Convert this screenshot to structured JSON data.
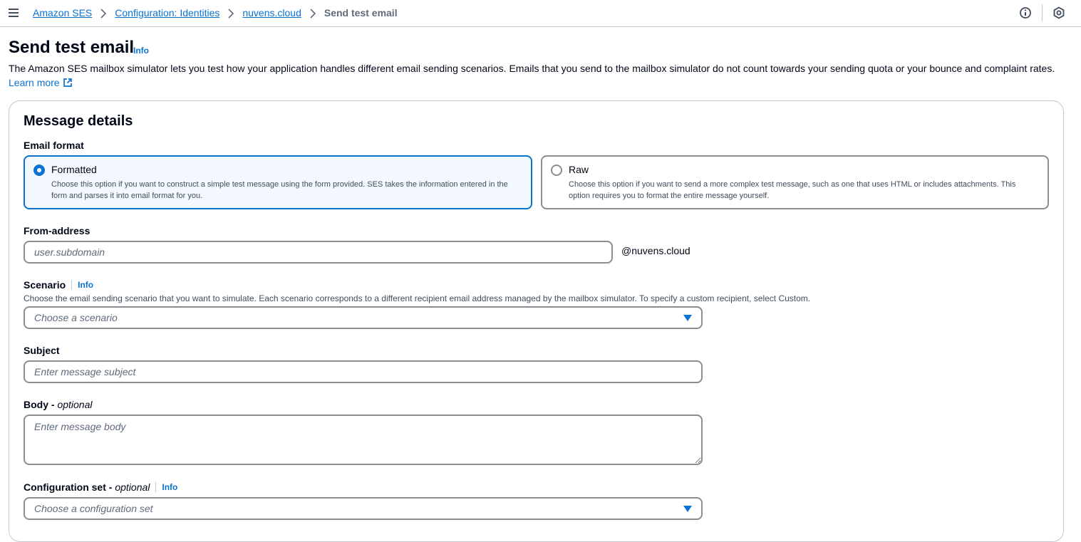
{
  "breadcrumb": {
    "items": [
      "Amazon SES",
      "Configuration: Identities",
      "nuvens.cloud"
    ],
    "current": "Send test email"
  },
  "page": {
    "title": "Send test email",
    "info": "Info",
    "description": "The Amazon SES mailbox simulator lets you test how your application handles different email sending scenarios. Emails that you send to the mailbox simulator do not count towards your sending quota or your bounce and complaint rates.",
    "learn_more": "Learn more"
  },
  "message_details": {
    "title": "Message details",
    "email_format": {
      "label": "Email format",
      "options": [
        {
          "label": "Formatted",
          "description": "Choose this option if you want to construct a simple test message using the form provided. SES takes the information entered in the form and parses it into email format for you.",
          "selected": true
        },
        {
          "label": "Raw",
          "description": "Choose this option if you want to send a more complex test message, such as one that uses HTML or includes attachments. This option requires you to format the entire message yourself.",
          "selected": false
        }
      ]
    },
    "from_address": {
      "label": "From-address",
      "placeholder": "user.subdomain",
      "suffix": "@nuvens.cloud"
    },
    "scenario": {
      "label": "Scenario",
      "info": "Info",
      "hint": "Choose the email sending scenario that you want to simulate. Each scenario corresponds to a different recipient email address managed by the mailbox simulator. To specify a custom recipient, select Custom.",
      "placeholder": "Choose a scenario"
    },
    "subject": {
      "label": "Subject",
      "placeholder": "Enter message subject"
    },
    "body": {
      "label": "Body",
      "optional": "optional",
      "placeholder": "Enter message body"
    },
    "configuration_set": {
      "label": "Configuration set",
      "optional": "optional",
      "info": "Info",
      "placeholder": "Choose a configuration set"
    }
  },
  "colors": {
    "link": "#0972d3",
    "border": "#8c8c94",
    "text": "#000716",
    "selected_bg": "#f2f8fd"
  },
  "icons": [
    "menu-icon",
    "chevron-right-icon",
    "info-circle-icon",
    "notification-icon",
    "external-link-icon",
    "caret-down-icon"
  ]
}
